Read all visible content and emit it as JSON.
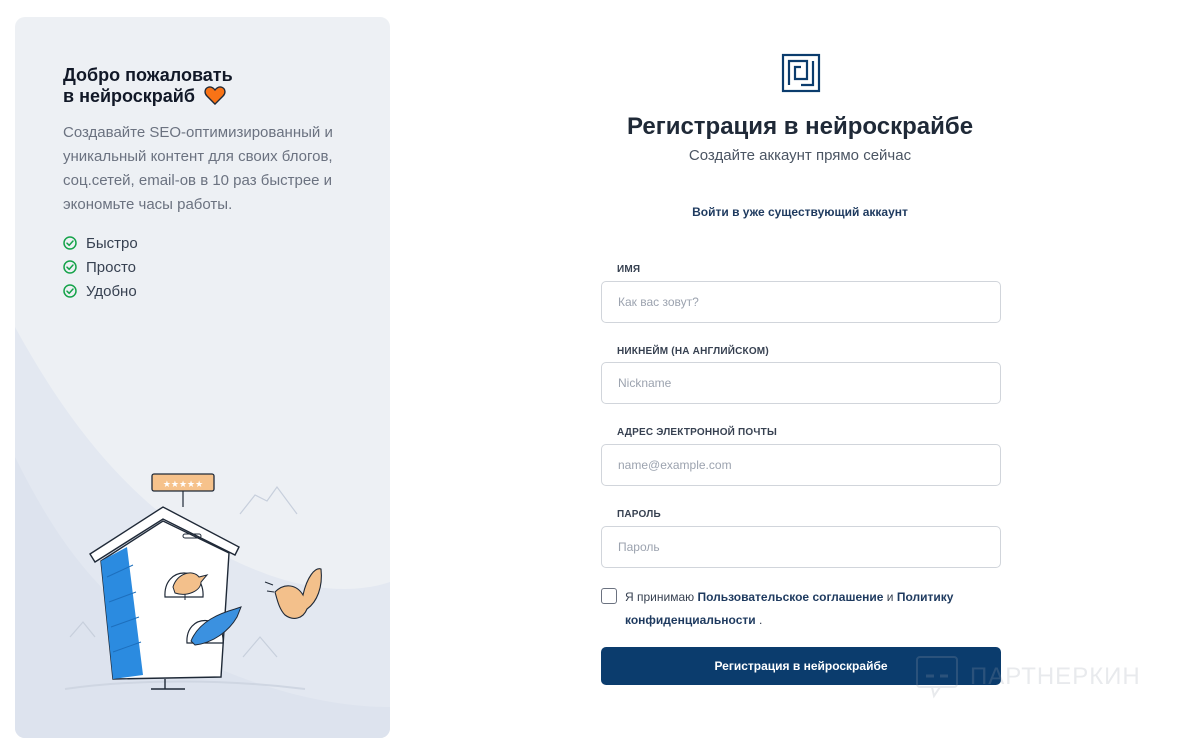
{
  "left": {
    "title_line1": "Добро пожаловать",
    "title_line2": "в нейроскрайб",
    "description": "Создавайте SEO-оптимизированный и уникальный контент для своих блогов, соц.сетей, email-ов в 10 раз быстрее и экономьте часы работы.",
    "features": [
      "Быстро",
      "Просто",
      "Удобно"
    ],
    "rating_stars": "★★★★★"
  },
  "form": {
    "title": "Регистрация в нейроскрайбе",
    "subtitle": "Создайте аккаунт прямо сейчас",
    "login_link": "Войти в уже существующий аккаунт",
    "name_label": "ИМЯ",
    "name_placeholder": "Как вас зовут?",
    "nickname_label": "НИКНЕЙМ (НА АНГЛИЙСКОМ)",
    "nickname_placeholder": "Nickname",
    "email_label": "АДРЕС ЭЛЕКТРОННОЙ ПОЧТЫ",
    "email_placeholder": "name@example.com",
    "password_label": "ПАРОЛЬ",
    "password_placeholder": "Пароль",
    "agree_prefix": "Я принимаю",
    "agree_terms": "Пользовательское соглашение",
    "agree_and": "и",
    "agree_privacy": "Политику конфиденциальности",
    "agree_suffix": ".",
    "submit_label": "Регистрация в нейроскрайбе"
  },
  "watermark": {
    "text": "ПАРТНЕРКИН"
  },
  "colors": {
    "primary": "#0b3c6d",
    "check_green": "#16a34a",
    "panel_bg": "#edf0f4",
    "heart": "#f97316"
  },
  "icons": {
    "logo": "neuroscribe-logo-icon",
    "heart": "heart-icon",
    "check": "check-circle-icon"
  }
}
